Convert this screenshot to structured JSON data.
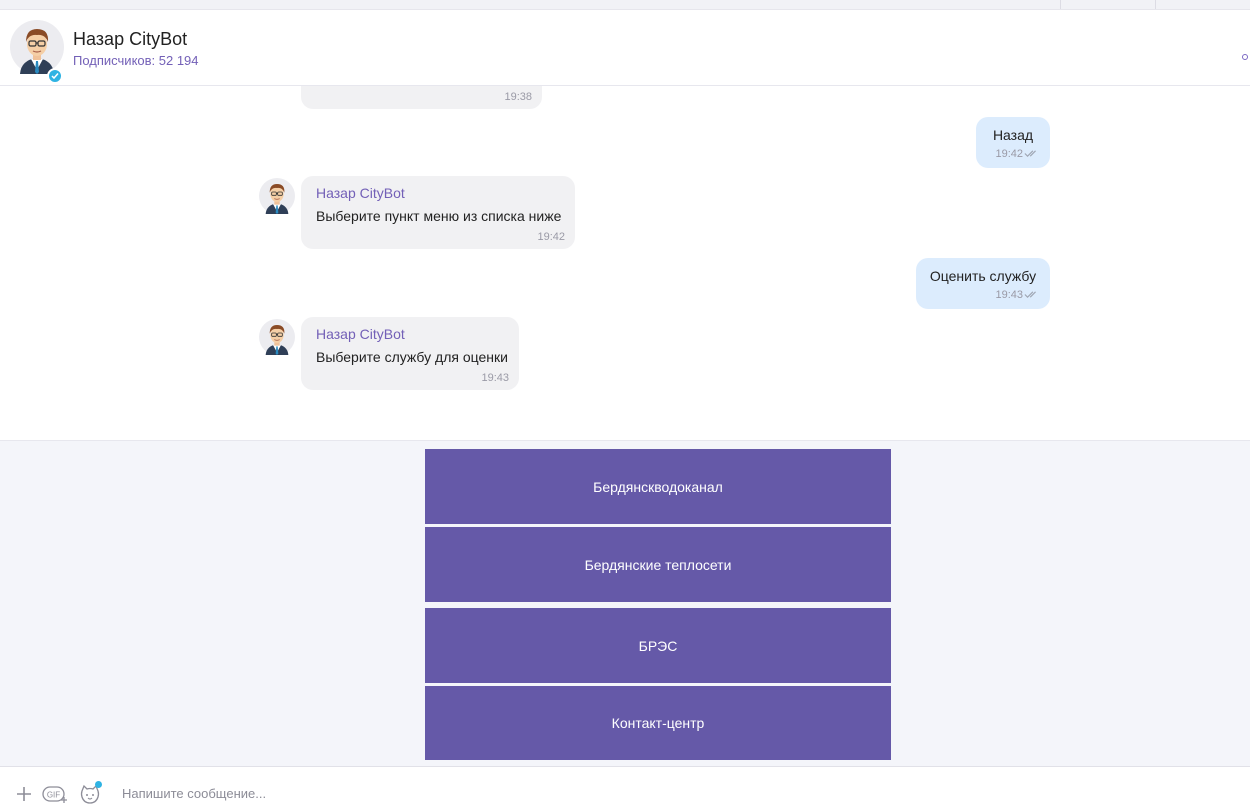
{
  "header": {
    "title": "Назар CityBot",
    "subtitle": "Подписчиков: 52 194"
  },
  "messages": [
    {
      "direction": "in",
      "time": "19:38"
    },
    {
      "direction": "out",
      "text": "Назад",
      "time": "19:42"
    },
    {
      "direction": "in",
      "sender": "Назар CityBot",
      "text": "Выберите пункт меню из списка ниже",
      "time": "19:42"
    },
    {
      "direction": "out",
      "text": "Оценить службу",
      "time": "19:43"
    },
    {
      "direction": "in",
      "sender": "Назар CityBot",
      "text": "Выберите службу для оценки",
      "time": "19:43"
    }
  ],
  "keyboard": {
    "buttons": [
      "Бердянскводоканал",
      "Бердянские теплосети",
      "БРЭС",
      "Контакт-центр"
    ]
  },
  "composer": {
    "placeholder": "Напишите сообщение..."
  },
  "colors": {
    "accent": "#7360b7",
    "button_bg": "#6559a8",
    "outgoing_bubble": "#dcecfd",
    "incoming_bubble": "#f1f1f3"
  },
  "icons": [
    "add-icon",
    "gif-icon",
    "sticker-icon",
    "read-ticks-icon",
    "verified-icon"
  ]
}
